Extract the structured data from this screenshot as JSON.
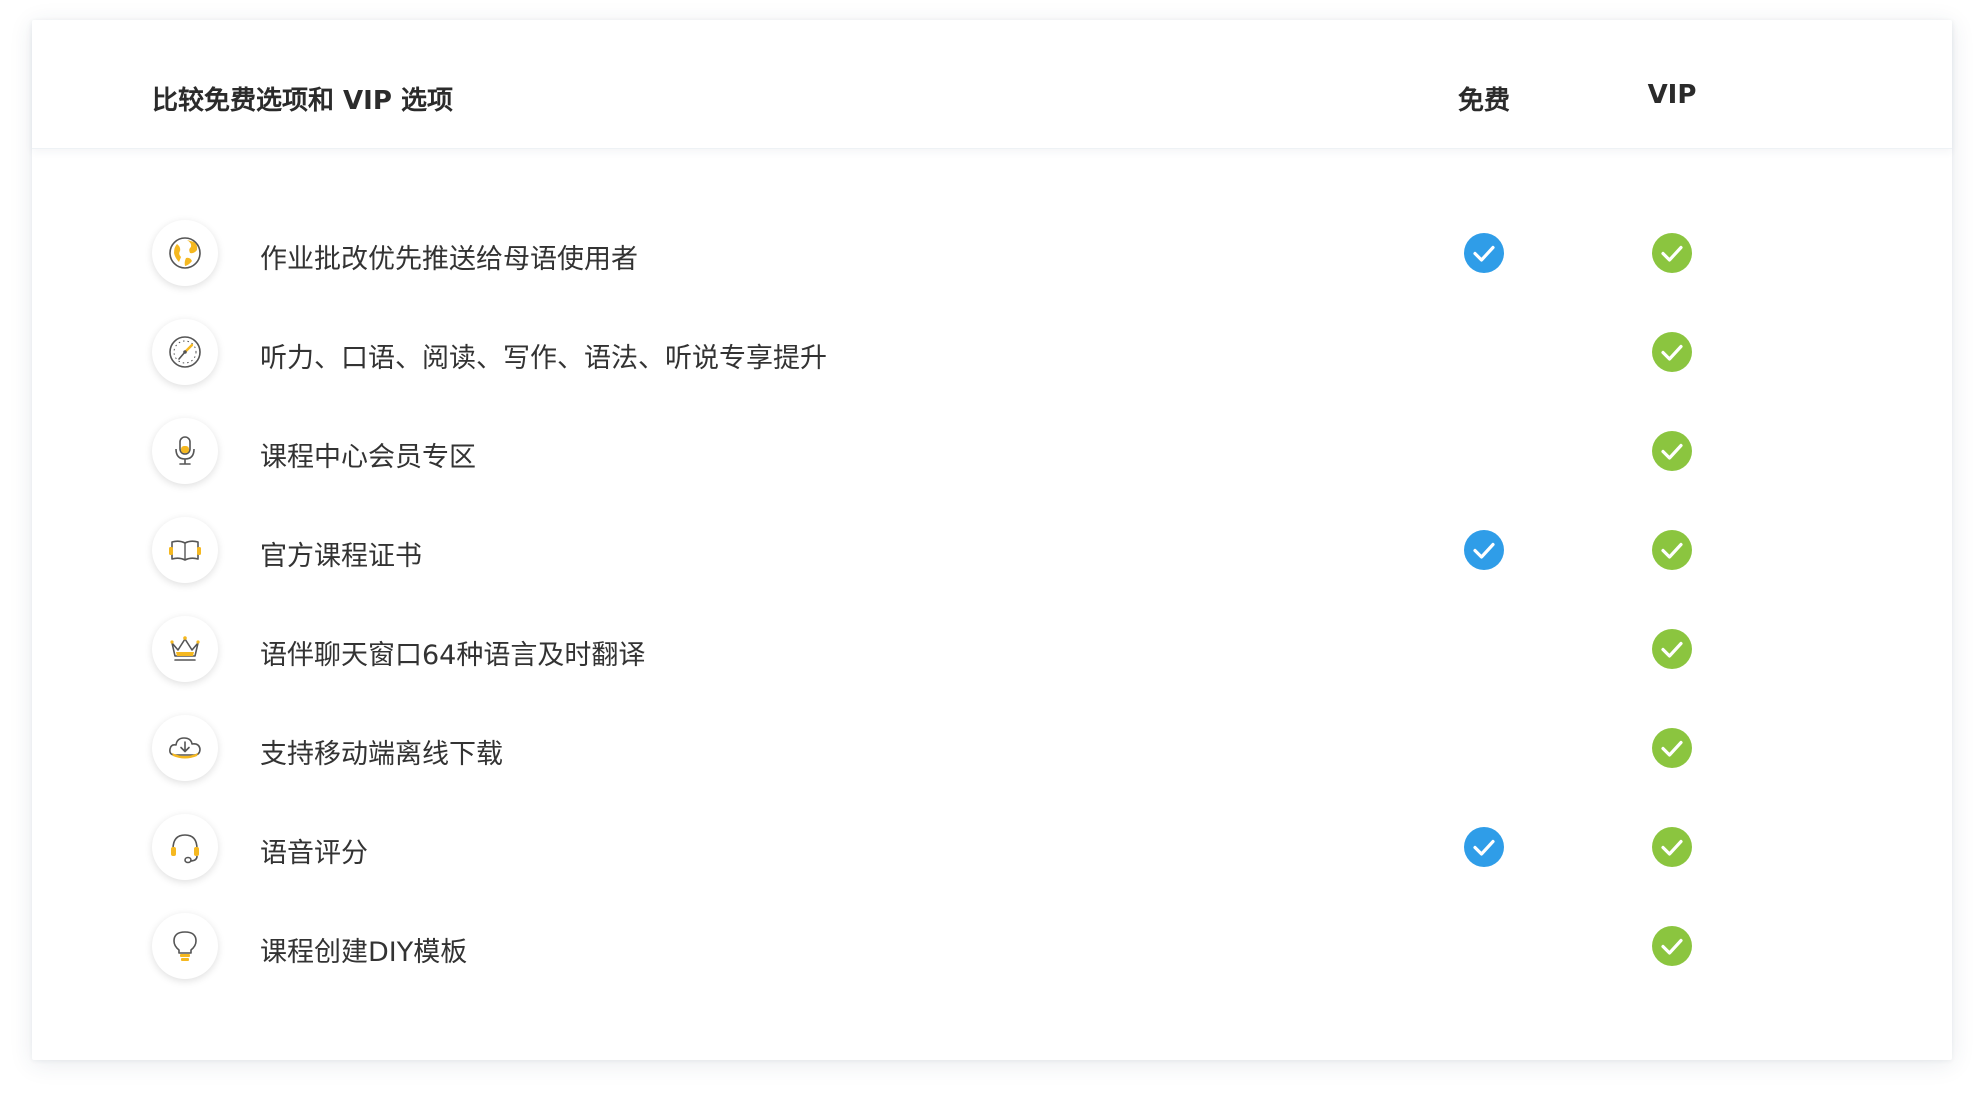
{
  "header": {
    "title": "比较免费选项和 VIP 选项",
    "col_free": "免费",
    "col_vip": "VIP"
  },
  "colors": {
    "free_check": "#2f9de8",
    "vip_check": "#8bc53f",
    "icon_accent": "#f5b820",
    "text": "#333333"
  },
  "rows": [
    {
      "label": "作业批改优先推送给母语使用者",
      "icon": "globe-icon",
      "free": true,
      "vip": true
    },
    {
      "label": "听力、口语、阅读、写作、语法、听说专享提升",
      "icon": "compass-icon",
      "free": false,
      "vip": true
    },
    {
      "label": "课程中心会员专区",
      "icon": "microphone-icon",
      "free": false,
      "vip": true
    },
    {
      "label": "官方课程证书",
      "icon": "book-icon",
      "free": true,
      "vip": true
    },
    {
      "label": "语伴聊天窗口64种语言及时翻译",
      "icon": "crown-icon",
      "free": false,
      "vip": true
    },
    {
      "label": "支持移动端离线下载",
      "icon": "cloud-download-icon",
      "free": false,
      "vip": true
    },
    {
      "label": "语音评分",
      "icon": "headset-icon",
      "free": true,
      "vip": true
    },
    {
      "label": "课程创建DIY模板",
      "icon": "lightbulb-icon",
      "free": false,
      "vip": true
    }
  ]
}
